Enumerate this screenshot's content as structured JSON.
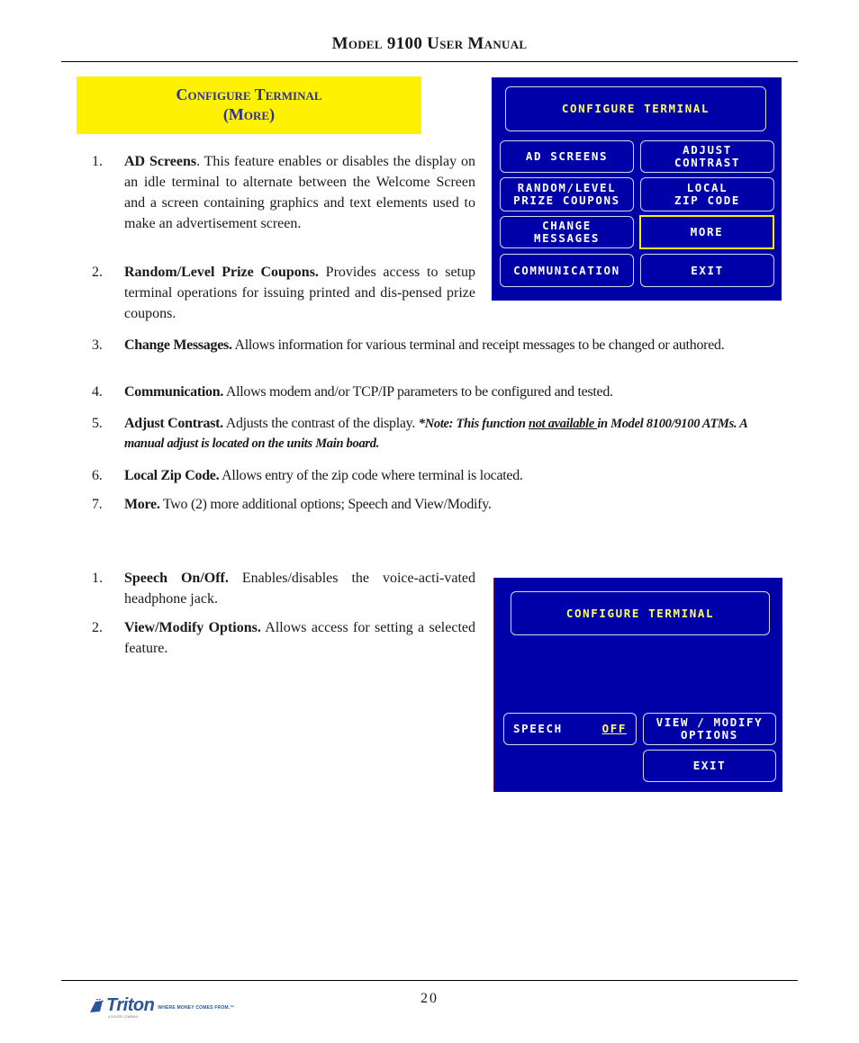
{
  "header": {
    "title": "Model 9100 User Manual"
  },
  "section": {
    "title_line1": "Configure Terminal",
    "title_line2": "(More)"
  },
  "items_main": [
    {
      "num": "1.",
      "label": "AD Screens",
      "after_label": ".",
      "text": " This feature enables or disables the display on an idle terminal to alternate between the Welcome Screen and a screen containing graphics and text elements used to make an advertisement screen."
    },
    {
      "num": "2.",
      "label": "Random/Level Prize Coupons.",
      "text": "  Provides access to setup terminal operations for issuing printed and dis-pensed prize coupons."
    },
    {
      "num": "3.",
      "label": "Change Messages.",
      "text": "  Allows information for various terminal and receipt messages to be changed or authored."
    },
    {
      "num": "4.",
      "label": "Communication.",
      "text": " Allows modem  and/or TCP/IP parameters to be configured and tested."
    },
    {
      "num": "5.",
      "label": "Adjust Contrast.",
      "text": "  Adjusts the contrast of the display. ",
      "note_pre": "*Note: This function ",
      "note_underlined": "not available ",
      "note_post": "in Model 8100/9100 ATMs. A manual adjust is located on the units Main board."
    },
    {
      "num": "6.",
      "label": "Local Zip Code.",
      "text": " Allows entry of the zip code where terminal is located."
    },
    {
      "num": "7.",
      "label": "More.",
      "text": " Two (2) more additional options; Speech and View/Modify."
    }
  ],
  "items_more": [
    {
      "num": "1.",
      "label": "Speech On/Off.",
      "text": "  Enables/disables the voice-acti-vated headphone jack."
    },
    {
      "num": "2.",
      "label": "View/Modify Options.",
      "text": "  Allows access for setting a selected feature."
    }
  ],
  "screen1": {
    "title": "CONFIGURE TERMINAL",
    "buttons": {
      "ad_screens": [
        "AD SCREENS"
      ],
      "adjust_contrast": [
        "ADJUST",
        "CONTRAST"
      ],
      "random_level": [
        "RANDOM/LEVEL",
        "PRIZE COUPONS"
      ],
      "local_zip": [
        "LOCAL",
        "ZIP CODE"
      ],
      "change_messages": [
        "CHANGE",
        "MESSAGES"
      ],
      "more": [
        "MORE"
      ],
      "communication": [
        "COMMUNICATION"
      ],
      "exit": [
        "EXIT"
      ]
    },
    "selected": "more"
  },
  "screen2": {
    "title": "CONFIGURE TERMINAL",
    "speech_label": "SPEECH",
    "speech_value": "OFF",
    "view_modify": [
      "VIEW / MODIFY",
      "OPTIONS"
    ],
    "exit": "EXIT"
  },
  "colors": {
    "screen_bg": "#0000a8",
    "section_bg": "#fff200",
    "section_text": "#2e3192",
    "highlight": "#ffee00"
  },
  "footer": {
    "page_number": "20",
    "logo_word": "Triton",
    "logo_tagline": "WHERE MONEY COMES FROM.™",
    "logo_sub": "A DOVER COMPANY"
  }
}
